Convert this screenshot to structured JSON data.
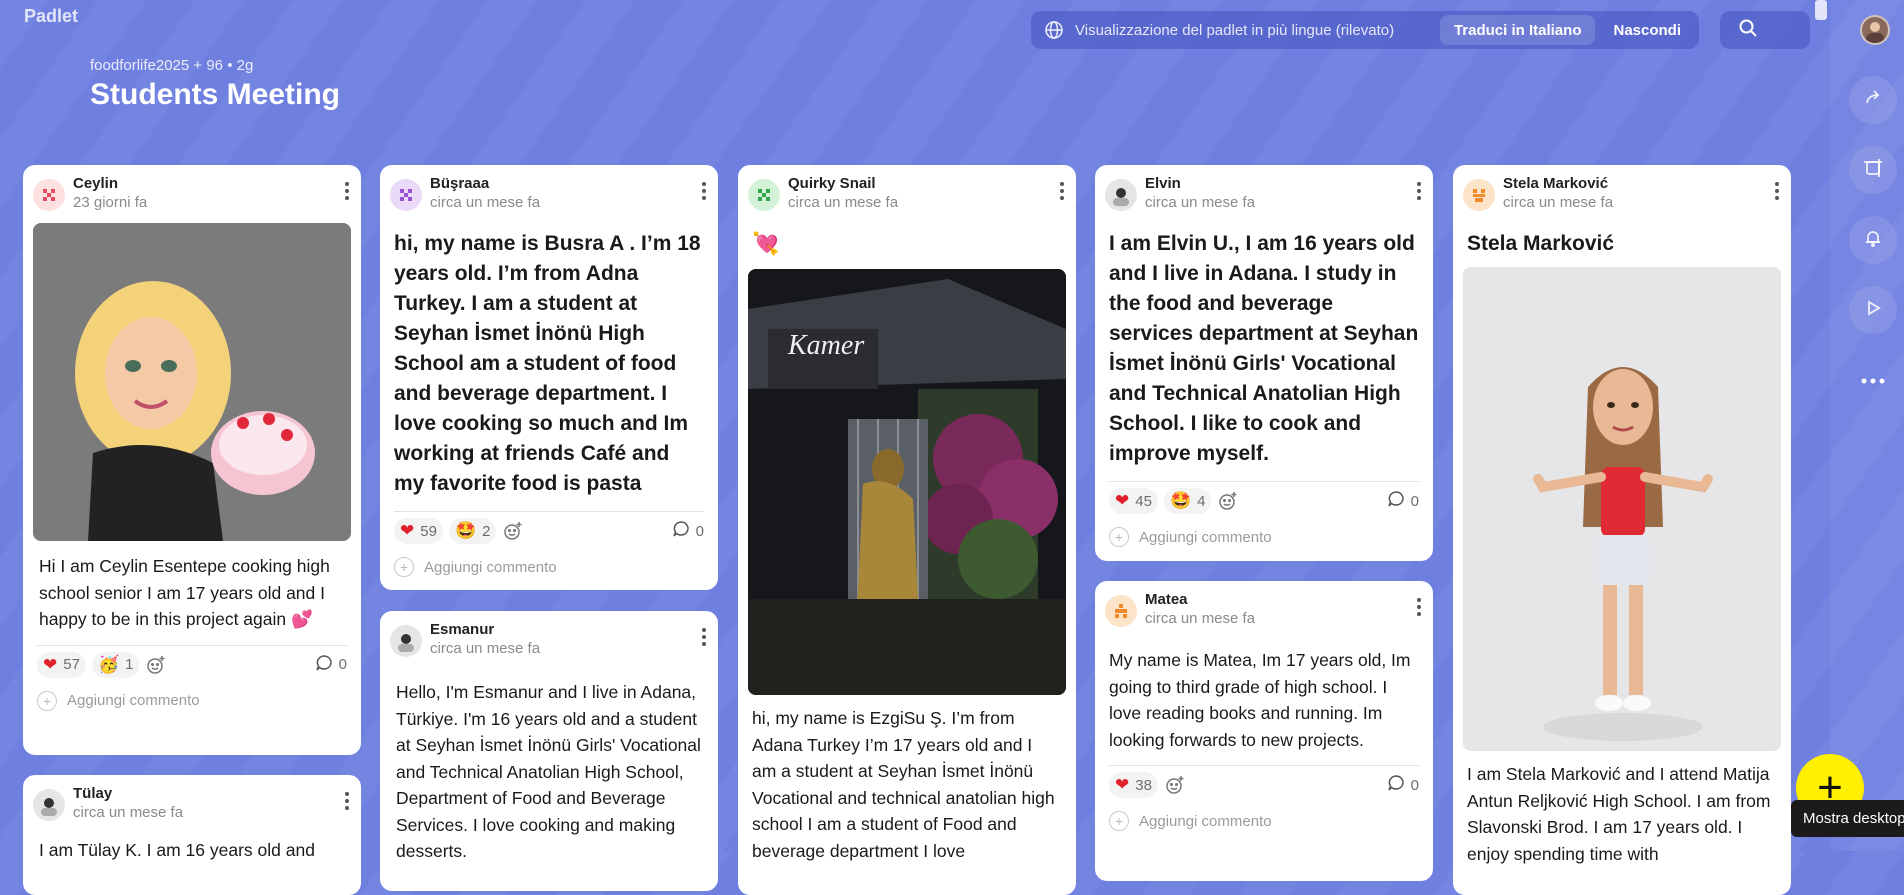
{
  "app": {
    "logo": "Padlet"
  },
  "board": {
    "meta": "foodforlife2025 + 96 • 2g",
    "title": "Students Meeting"
  },
  "lang_bar": {
    "message": "Visualizzazione del padlet in più lingue (rilevato)",
    "translate_label": "Traduci in Italiano",
    "hide_label": "Nascondi"
  },
  "fab": {
    "label": "+",
    "tooltip": "Mostra desktop"
  },
  "cards": {
    "ceylin": {
      "author": "Ceylin",
      "time": "23 giorni fa",
      "body": "Hi I am Ceylin Esentepe cooking high school senior I am 17 years old and I happy to be in this project again 💕",
      "heart_count": "57",
      "react2_count": "1",
      "comments": "0",
      "add_comment": "Aggiungi commento"
    },
    "tulay": {
      "author": "Tülay",
      "time": "circa un mese fa",
      "body": "I am Tülay K. I am 16 years old and"
    },
    "busraaa": {
      "author": "Büşraaa",
      "time": "circa un mese fa",
      "title": "hi, my name is Busra A . I’m 18 years old. I’m from Adna Turkey. I am a student  at Seyhan İsmet İnönü High School am a student of food and beverage department. I love cooking so much and Im working at friends Café and my favorite food is pasta",
      "heart_count": "59",
      "react2_count": "2",
      "comments": "0",
      "add_comment": "Aggiungi commento"
    },
    "esmanur": {
      "author": "Esmanur",
      "time": "circa un mese fa",
      "body": "Hello, I'm Esmanur and I live in Adana, Türkiye. I'm 16 years old and a student at Seyhan İsmet İnönü Girls' Vocational and Technical Anatolian High School, Department of Food and Beverage Services. I love cooking and making desserts."
    },
    "quirky": {
      "author": "Quirky Snail",
      "time": "circa un mese fa",
      "emoji": "💘",
      "sign_text": "Kamer",
      "body": "hi, my name is EzgiSu Ş. I’m from Adana Turkey I’m 17 years old and I am a student at Seyhan İsmet İnönü Vocational and technical anatolian high school I am a student of Food and beverage department I love"
    },
    "elvin": {
      "author": "Elvin",
      "time": "circa un mese fa",
      "title": "I am Elvin U., I am 16 years old and I live in Adana. I study in the food and beverage services department at Seyhan İsmet İnönü Girls' Vocational and Technical Anatolian High School. I like to cook and improve myself.",
      "heart_count": "45",
      "react2_count": "4",
      "comments": "0",
      "add_comment": "Aggiungi commento"
    },
    "matea": {
      "author": "Matea",
      "time": "circa un mese fa",
      "body": "My name is Matea, Im 17 years old, Im going to third grade of high school. I love reading books and running. Im looking forwards to new projects.",
      "heart_count": "38",
      "comments": "0",
      "add_comment": "Aggiungi commento"
    },
    "stela": {
      "author": "Stela Marković",
      "time": "circa un mese fa",
      "title": "Stela Marković",
      "body": "I am Stela Marković and I attend Matija Antun Reljković High School. I am from Slavonski Brod. I am 17 years old. I enjoy spending time with"
    }
  },
  "colors": {
    "background": "#6f7fe0",
    "fab": "#ffef00",
    "heart": "#e0202a"
  },
  "icons": [
    "globe-icon",
    "search-icon",
    "share-icon",
    "remake-icon",
    "bell-icon",
    "play-icon",
    "more-icon",
    "heart-icon",
    "star-eyes-icon",
    "add-reaction-icon",
    "comment-icon"
  ]
}
